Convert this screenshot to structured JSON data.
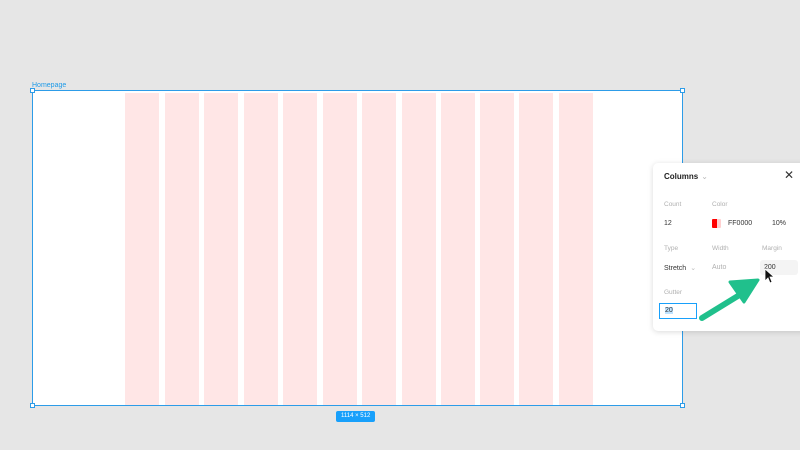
{
  "frame": {
    "name": "Homepage",
    "size_badge": "1114 × 512",
    "column_count": 12,
    "column_color": "#ffe6e6",
    "selection_color": "#2d9ce8"
  },
  "panel": {
    "title": "Columns",
    "close_icon": "close-icon",
    "count": {
      "label": "Count",
      "value": "12"
    },
    "color": {
      "label": "Color",
      "hex": "FF0000",
      "opacity": "10%",
      "swatch": "#ff0000"
    },
    "type": {
      "label": "Type",
      "value": "Stretch"
    },
    "width": {
      "label": "Width",
      "value": "Auto"
    },
    "margin": {
      "label": "Margin",
      "value": "200"
    },
    "gutter": {
      "label": "Gutter",
      "value": "20"
    }
  },
  "annotation": {
    "arrow_color": "#20c08c",
    "cursor_icon": "mouse-pointer-icon"
  }
}
